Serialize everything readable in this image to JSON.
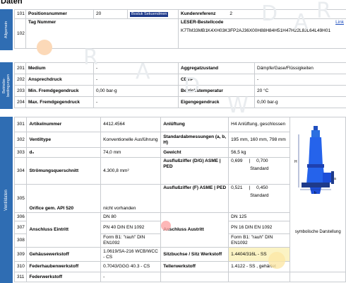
{
  "title": "Daten",
  "watermark": [
    "R",
    "A",
    "D",
    "W",
    "A",
    "R",
    "D"
  ],
  "sections": {
    "general": {
      "label": "Allgemein"
    },
    "operating": {
      "label": "Betriebs-\nbedingungen"
    },
    "valve": {
      "label": "Ventildaten"
    }
  },
  "r101": {
    "num": "101",
    "label": "Positionsnummer",
    "value": "20",
    "btn": "Bosluk Sekuendmen",
    "label2": "Kundenreferenz",
    "value2": "2"
  },
  "r102": {
    "num": "102",
    "label": "Tag Nummer",
    "label2": "LESER-Bestellcode",
    "link": "Link",
    "code": "K7TM33MB1K4XH03K3FP2AJ36X00H88H84H51H47H22L8JL64L49H01"
  },
  "r201": {
    "num": "201",
    "label": "Medium",
    "value": "-",
    "label2": "Aggregatzustand",
    "value2": "Dämpfe/Gase/Flüssigkeiten"
  },
  "r202": {
    "num": "202",
    "label": "Ansprechdruck",
    "value": "-",
    "label2": "CDTP",
    "value2": "-"
  },
  "r203": {
    "num": "203",
    "label": "Min. Fremdgegendruck",
    "value": "0,00 bar-g",
    "label2": "Betriebstemperatur",
    "value2": "20 °C"
  },
  "r204": {
    "num": "204",
    "label": "Max. Fremdgegendruck",
    "value": "-",
    "label2": "Eigengegendruck",
    "value2": "0,00 bar-g"
  },
  "r301": {
    "num": "301",
    "label": "Artikelnummer",
    "value": "4412.4564",
    "label2": "Anlüftung",
    "value2": "H4 Anlüftung, geschlossen"
  },
  "r302": {
    "num": "302",
    "label": "Ventiltype",
    "value": "Konventionelle Ausführung",
    "label2": "Standardabmessungen (a, b, H)",
    "value2": "195 mm, 160 mm, 798 mm"
  },
  "r303": {
    "num": "303",
    "label": "d₀",
    "value": "74,0 mm",
    "label2": "Gewicht",
    "value2": "56,5 kg"
  },
  "r304": {
    "num": "304",
    "label": "Strömungsquerschnitt",
    "value": "4.300,8 mm²",
    "label2": "Ausflußziffer (D/G) ASME | PED",
    "value2": "0,699     |     0,700",
    "sub2": "Standard"
  },
  "r305": {
    "num": "305",
    "label": "Orifice gem. API 520",
    "value": "nicht vorhanden",
    "label2": "Ausflußziffer (F) ASME | PED",
    "value2": "0,521     |     0,450",
    "sub2": "Standard"
  },
  "r306": {
    "num": "306",
    "value": "DN 80",
    "value2": "DN 125"
  },
  "r307": {
    "num": "307",
    "label": "Anschluss Eintritt",
    "value": "PN 40 DIN EN 1092",
    "label2": "Anschluss Austritt",
    "value2": "PN 16 DIN EN 1092"
  },
  "r308": {
    "num": "308",
    "value": "Form B1: \"rauh\" DIN EN1092",
    "value2": "Form B1: \"rauh\" DIN EN1092"
  },
  "r309": {
    "num": "309",
    "label": "Gehäusewerkstoff",
    "value": "1.0619/SA-216 WCB/WCC - CS",
    "label2": "Sitzbuchse / Sitz Werkstoff",
    "value2": "1.4404/316L - SS"
  },
  "r310": {
    "num": "310",
    "label": "Federhaubenwerkstoff",
    "value": "0.7043/GGG 40.3 - CS",
    "label2": "Tellerwerkstoff",
    "value2": "1.4122 - SS , gehärtet"
  },
  "r311": {
    "num": "311",
    "label": "Federwerkstoff",
    "value": "-"
  },
  "symbol_caption": "symbolische Darstellung",
  "colors": {
    "accent": "#2f6db3",
    "button": "#1e3a8a",
    "link": "#1f4fbf",
    "highlight": "#fbf3c4"
  }
}
